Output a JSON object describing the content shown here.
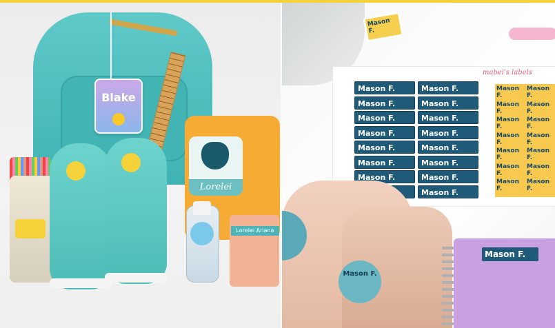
{
  "left_photo": {
    "bag_tag_name": "Blake",
    "lunchbox_name": "Lorelei",
    "lunchbag_label": "Lorelei Ariana"
  },
  "right_photo": {
    "brand": "mabel's labels",
    "clothing_tag_name": "Mason F.",
    "sheet_label": "Mason F.",
    "shoe_sticker_name": "Mason F.",
    "notebook_label": "Mason F."
  },
  "colors": {
    "accent_yellow": "#f6d23a",
    "label_navy": "#1f5a78",
    "teal": "#4cbcb6"
  }
}
